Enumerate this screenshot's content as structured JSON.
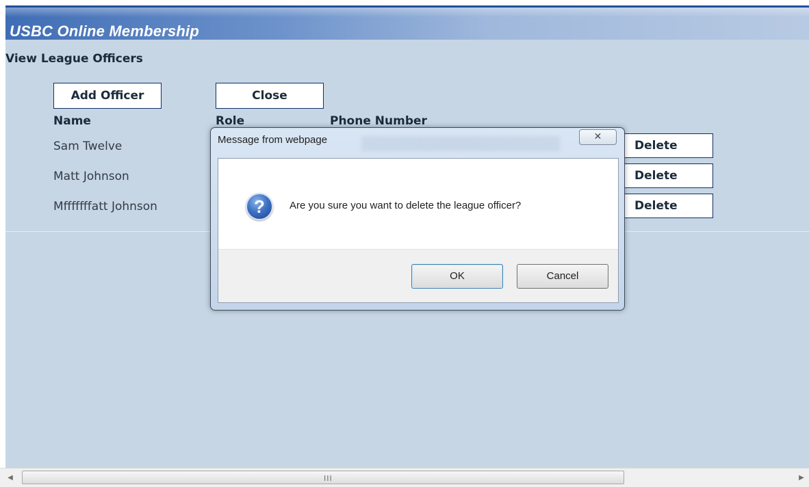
{
  "app": {
    "title": "USBC Online Membership"
  },
  "page": {
    "section_title": "View League Officers",
    "add_officer_label": "Add Officer",
    "close_label": "Close",
    "columns": {
      "name": "Name",
      "role": "Role",
      "phone": "Phone Number"
    },
    "officers": [
      {
        "name": "Sam Twelve",
        "delete_label": "Delete"
      },
      {
        "name": "Matt Johnson",
        "delete_label": "Delete"
      },
      {
        "name": "Mfffffffatt Johnson",
        "delete_label": "Delete"
      }
    ]
  },
  "dialog": {
    "title": "Message from webpage",
    "message": "Are you sure you want to delete the league officer?",
    "icon": "question-icon",
    "ok_label": "OK",
    "cancel_label": "Cancel",
    "close_glyph": "✕"
  },
  "scrollbar": {
    "left_arrow": "◀",
    "right_arrow": "▶",
    "grip": "III"
  },
  "colors": {
    "header": "#3f6db5",
    "page_bg": "#c6d6e5",
    "button_border": "#0f2f63"
  }
}
